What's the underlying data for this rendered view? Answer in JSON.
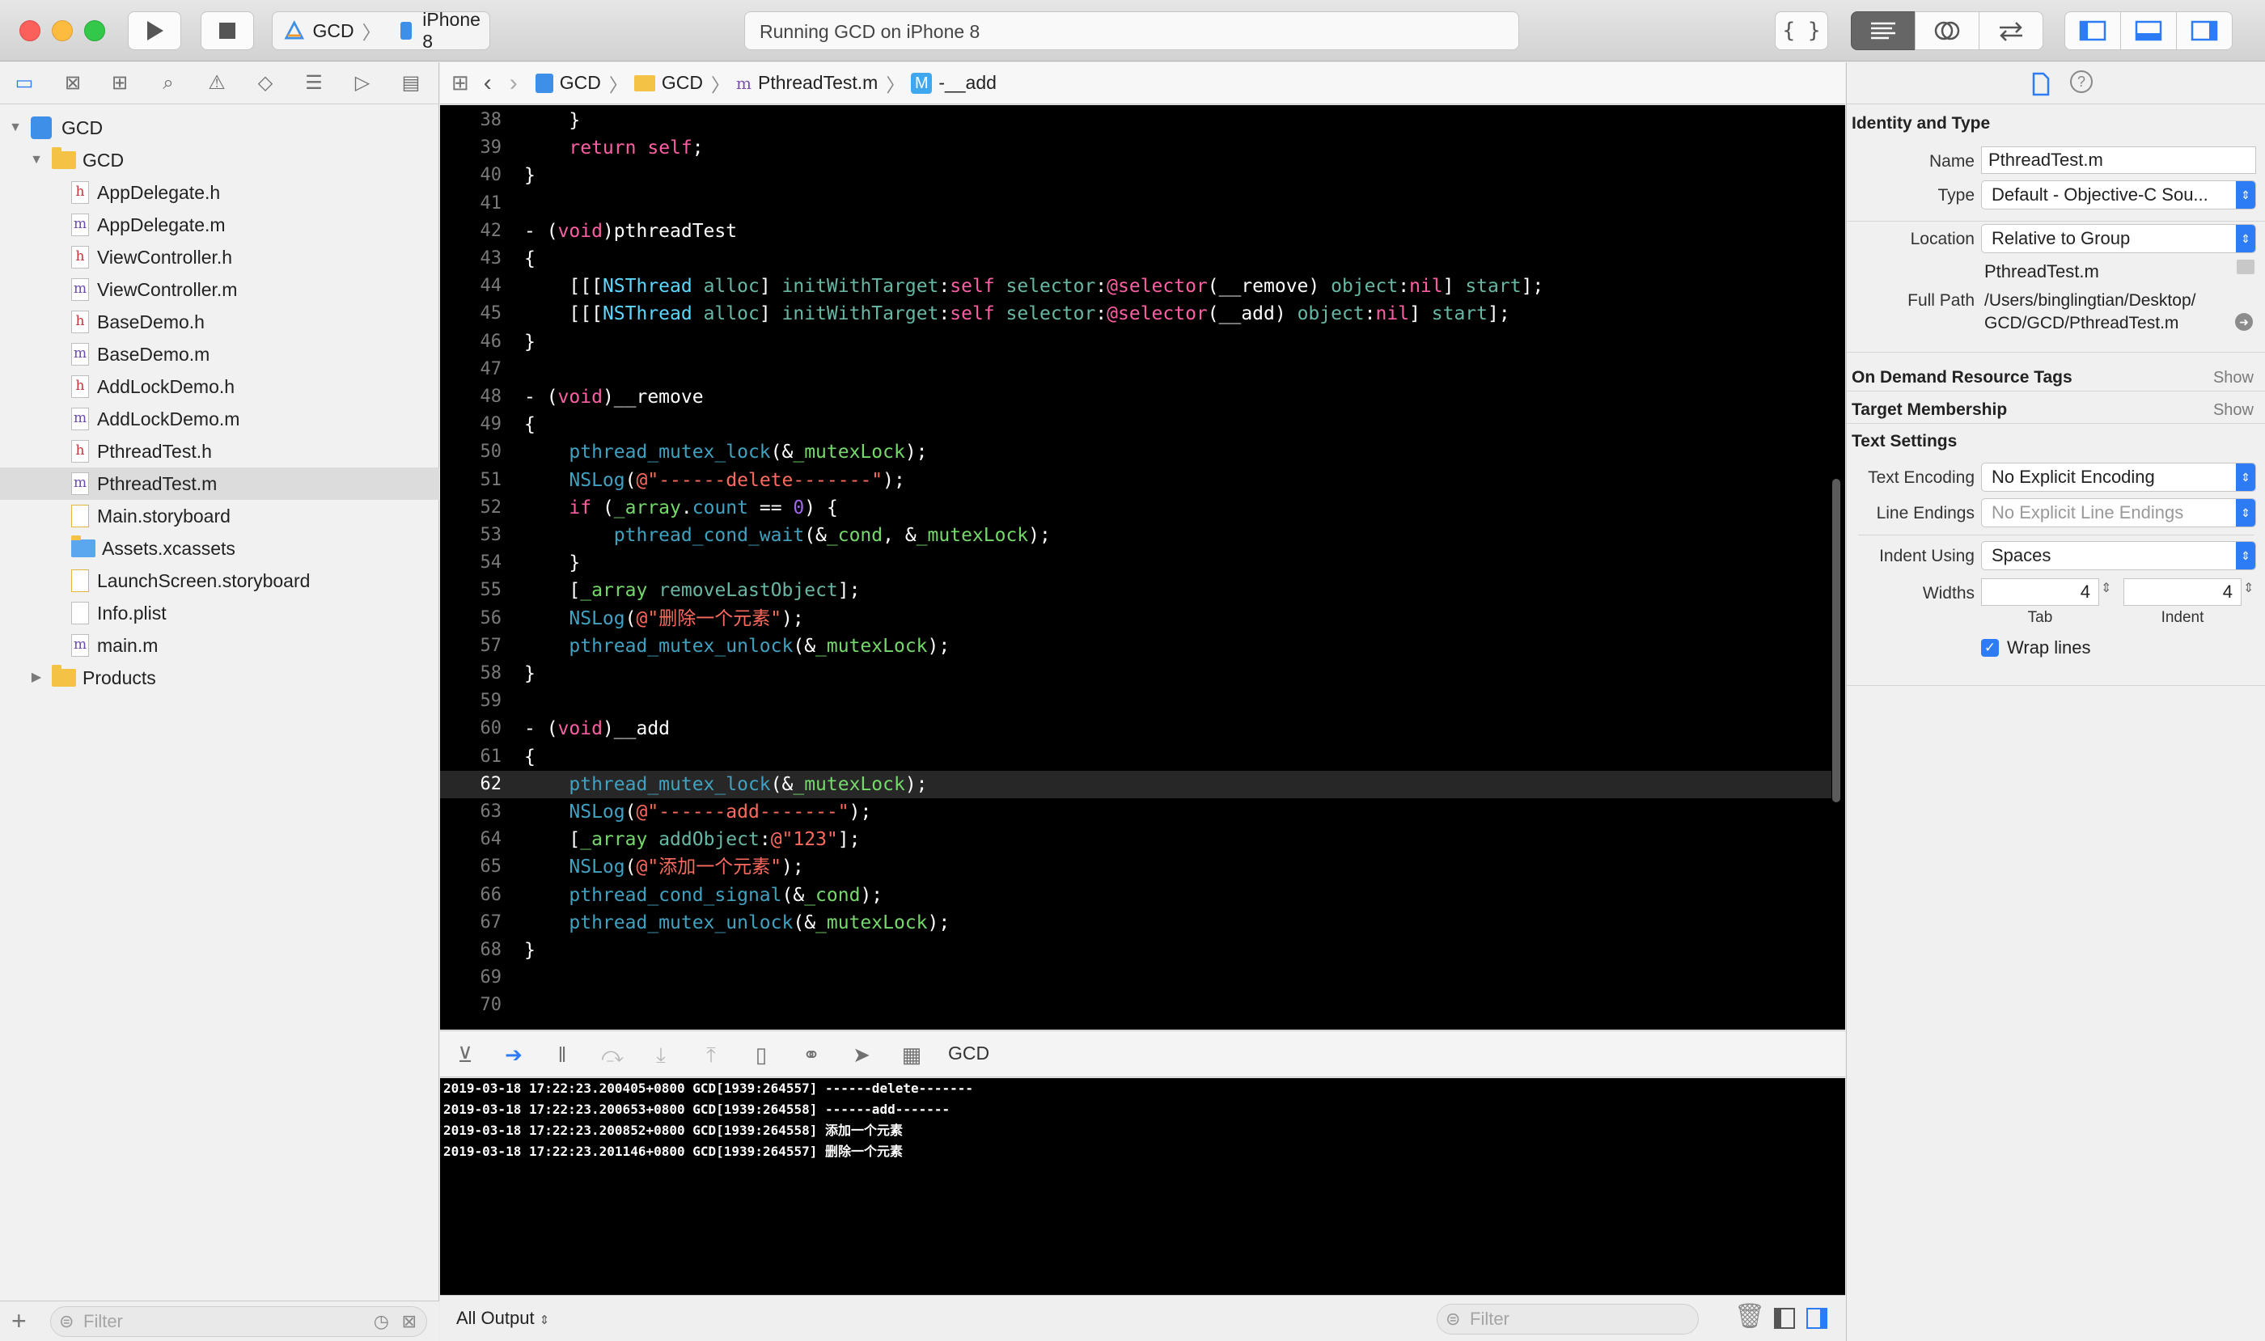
{
  "titlebar": {
    "scheme_project": "GCD",
    "scheme_device": "iPhone 8",
    "activity": "Running GCD on iPhone 8"
  },
  "navigator": {
    "items": [
      {
        "label": "GCD",
        "kind": "project",
        "indent": 0,
        "disclosure": "open"
      },
      {
        "label": "GCD",
        "kind": "folder",
        "indent": 1,
        "disclosure": "open"
      },
      {
        "label": "AppDelegate.h",
        "kind": "h",
        "indent": 2
      },
      {
        "label": "AppDelegate.m",
        "kind": "m",
        "indent": 2
      },
      {
        "label": "ViewController.h",
        "kind": "h",
        "indent": 2
      },
      {
        "label": "ViewController.m",
        "kind": "m",
        "indent": 2
      },
      {
        "label": "BaseDemo.h",
        "kind": "h",
        "indent": 2
      },
      {
        "label": "BaseDemo.m",
        "kind": "m",
        "indent": 2
      },
      {
        "label": "AddLockDemo.h",
        "kind": "h",
        "indent": 2
      },
      {
        "label": "AddLockDemo.m",
        "kind": "m",
        "indent": 2
      },
      {
        "label": "PthreadTest.h",
        "kind": "h",
        "indent": 2
      },
      {
        "label": "PthreadTest.m",
        "kind": "m",
        "indent": 2,
        "selected": true
      },
      {
        "label": "Main.storyboard",
        "kind": "storyboard",
        "indent": 2
      },
      {
        "label": "Assets.xcassets",
        "kind": "assets",
        "indent": 2
      },
      {
        "label": "LaunchScreen.storyboard",
        "kind": "storyboard",
        "indent": 2
      },
      {
        "label": "Info.plist",
        "kind": "plist",
        "indent": 2
      },
      {
        "label": "main.m",
        "kind": "m",
        "indent": 2
      },
      {
        "label": "Products",
        "kind": "folder",
        "indent": 1,
        "disclosure": "closed"
      }
    ],
    "filter_placeholder": "Filter"
  },
  "jumpbar": {
    "crumbs": [
      "GCD",
      "GCD",
      "PthreadTest.m",
      "-__add"
    ],
    "method_badge": "M"
  },
  "editor": {
    "current_line": 62,
    "lines": [
      {
        "n": "38",
        "html": "    }"
      },
      {
        "n": "39",
        "html": "    <span class='k'>return</span> <span class='k'>self</span>;"
      },
      {
        "n": "40",
        "html": "}"
      },
      {
        "n": "41",
        "html": ""
      },
      {
        "n": "42",
        "html": "- (<span class='k'>void</span>)pthreadTest"
      },
      {
        "n": "43",
        "html": "{"
      },
      {
        "n": "44",
        "html": "    [[[<span class='t'>NSThread</span> <span class='f'>alloc</span>] <span class='f'>initWithTarget</span>:<span class='k'>self</span> <span class='f'>selector</span>:<span class='k'>@selector</span>(__remove) <span class='f'>object</span>:<span class='k'>nil</span>] <span class='f'>start</span>];"
      },
      {
        "n": "45",
        "html": "    [[[<span class='t'>NSThread</span> <span class='f'>alloc</span>] <span class='f'>initWithTarget</span>:<span class='k'>self</span> <span class='f'>selector</span>:<span class='k'>@selector</span>(__add) <span class='f'>object</span>:<span class='k'>nil</span>] <span class='f'>start</span>];"
      },
      {
        "n": "46",
        "html": "}"
      },
      {
        "n": "47",
        "html": ""
      },
      {
        "n": "48",
        "html": "- (<span class='k'>void</span>)__remove"
      },
      {
        "n": "49",
        "html": "{"
      },
      {
        "n": "50",
        "html": "    <span class='p'>pthread_mutex_lock</span>(&amp;<span class='g'>_mutexLock</span>);"
      },
      {
        "n": "51",
        "html": "    <span class='p'>NSLog</span>(<span class='s'>@\"------delete-------\"</span>);"
      },
      {
        "n": "52",
        "html": "    <span class='k'>if</span> (<span class='g'>_array</span>.<span class='p'>count</span> == <span class='ni'>0</span>) {"
      },
      {
        "n": "53",
        "html": "        <span class='p'>pthread_cond_wait</span>(&amp;<span class='g'>_cond</span>, &amp;<span class='g'>_mutexLock</span>);"
      },
      {
        "n": "54",
        "html": "    }"
      },
      {
        "n": "55",
        "html": "    [<span class='g'>_array</span> <span class='f'>removeLastObject</span>];"
      },
      {
        "n": "56",
        "html": "    <span class='p'>NSLog</span>(<span class='s'>@\"删除一个元素\"</span>);"
      },
      {
        "n": "57",
        "html": "    <span class='p'>pthread_mutex_unlock</span>(&amp;<span class='g'>_mutexLock</span>);"
      },
      {
        "n": "58",
        "html": "}"
      },
      {
        "n": "59",
        "html": ""
      },
      {
        "n": "60",
        "html": "- (<span class='k'>void</span>)__add"
      },
      {
        "n": "61",
        "html": "{"
      },
      {
        "n": "62",
        "html": "    <span class='p'>pthread_mutex_lock</span>(&amp;<span class='g'>_mutexLock</span>);"
      },
      {
        "n": "63",
        "html": "    <span class='p'>NSLog</span>(<span class='s'>@\"------add-------\"</span>);"
      },
      {
        "n": "64",
        "html": "    [<span class='g'>_array</span> <span class='f'>addObject</span>:<span class='s'>@\"123\"</span>];"
      },
      {
        "n": "65",
        "html": "    <span class='p'>NSLog</span>(<span class='s'>@\"添加一个元素\"</span>);"
      },
      {
        "n": "66",
        "html": "    <span class='p'>pthread_cond_signal</span>(&amp;<span class='g'>_cond</span>);"
      },
      {
        "n": "67",
        "html": "    <span class='p'>pthread_mutex_unlock</span>(&amp;<span class='g'>_mutexLock</span>);"
      },
      {
        "n": "68",
        "html": "}"
      },
      {
        "n": "69",
        "html": ""
      },
      {
        "n": "70",
        "html": ""
      }
    ]
  },
  "debugbar": {
    "target": "GCD"
  },
  "console": {
    "lines": [
      "2019-03-18 17:22:23.200405+0800 GCD[1939:264557] ------delete-------",
      "2019-03-18 17:22:23.200653+0800 GCD[1939:264558] ------add-------",
      "2019-03-18 17:22:23.200852+0800 GCD[1939:264558] 添加一个元素",
      "2019-03-18 17:22:23.201146+0800 GCD[1939:264557] 删除一个元素"
    ],
    "output_selector": "All Output",
    "filter_placeholder": "Filter"
  },
  "inspector": {
    "identity_header": "Identity and Type",
    "name_label": "Name",
    "name_value": "PthreadTest.m",
    "type_label": "Type",
    "type_value": "Default - Objective-C Sou...",
    "location_label": "Location",
    "location_value": "Relative to Group",
    "location_file": "PthreadTest.m",
    "fullpath_label": "Full Path",
    "fullpath_line1": "/Users/binglingtian/Desktop/",
    "fullpath_line2": "GCD/GCD/PthreadTest.m",
    "odr_header": "On Demand Resource Tags",
    "odr_show": "Show",
    "target_header": "Target Membership",
    "target_show": "Show",
    "text_header": "Text Settings",
    "encoding_label": "Text Encoding",
    "encoding_value": "No Explicit Encoding",
    "endings_label": "Line Endings",
    "endings_value": "No Explicit Line Endings",
    "indent_label": "Indent Using",
    "indent_value": "Spaces",
    "widths_label": "Widths",
    "tab_value": "4",
    "indent_width_value": "4",
    "tab_caption": "Tab",
    "indent_caption": "Indent",
    "wrap_label": "Wrap lines",
    "wrap_checked": true
  }
}
